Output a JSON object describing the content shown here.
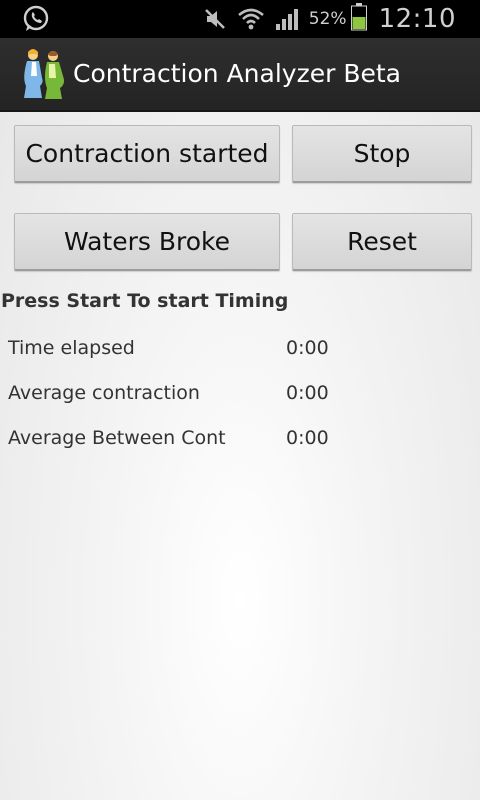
{
  "status_bar": {
    "battery_percent": "52%",
    "time": "12:10",
    "battery_level": 0.52,
    "icons": [
      "whatsapp-icon",
      "mute-icon",
      "wifi-icon",
      "signal-icon",
      "battery-icon"
    ]
  },
  "action_bar": {
    "title": "Contraction Analyzer Beta",
    "app_icon": "pregnant-women-icon"
  },
  "buttons": {
    "contraction_started": "Contraction started",
    "stop": "Stop",
    "waters_broke": "Waters Broke",
    "reset": "Reset"
  },
  "instruction": "Press Start To start Timing",
  "stats": [
    {
      "label": "Time elapsed",
      "value": "0:00"
    },
    {
      "label": "Average contraction",
      "value": "0:00"
    },
    {
      "label": "Average Between Cont",
      "value": "0:00"
    }
  ],
  "colors": {
    "action_bar_bg": "#272727",
    "status_bar_bg": "#000000",
    "battery_green": "#8ec641"
  }
}
